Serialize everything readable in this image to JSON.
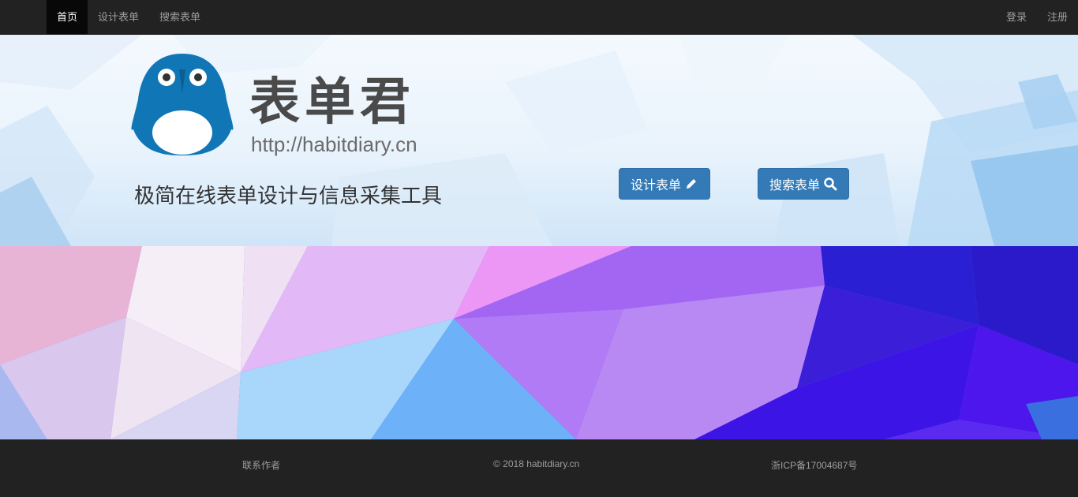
{
  "navbar": {
    "items": [
      {
        "label": "首页",
        "active": true
      },
      {
        "label": "设计表单"
      },
      {
        "label": "搜索表单"
      }
    ],
    "right": [
      {
        "label": "登录"
      },
      {
        "label": "注册"
      }
    ]
  },
  "hero": {
    "brand_title": "表单君",
    "brand_url": "http://habitdiary.cn",
    "tagline": "极简在线表单设计与信息采集工具",
    "buttons": [
      {
        "label": "设计表单",
        "icon": "pencil-icon"
      },
      {
        "label": "搜索表单",
        "icon": "search-icon"
      }
    ],
    "colors": {
      "button": "#337ab7",
      "logo": "#1176b5"
    }
  },
  "footer": {
    "contact": "联系作者",
    "copyright": "© 2018 habitdiary.cn",
    "icp": "浙ICP备17004687号"
  }
}
